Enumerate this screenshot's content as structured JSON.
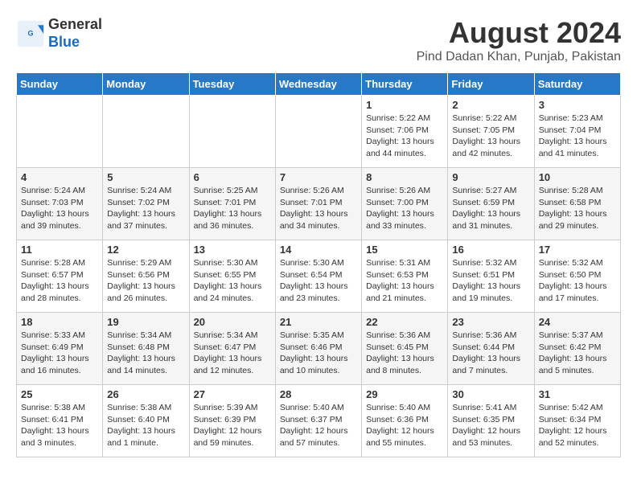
{
  "header": {
    "logo_line1": "General",
    "logo_line2": "Blue",
    "main_title": "August 2024",
    "subtitle": "Pind Dadan Khan, Punjab, Pakistan"
  },
  "calendar": {
    "weekdays": [
      "Sunday",
      "Monday",
      "Tuesday",
      "Wednesday",
      "Thursday",
      "Friday",
      "Saturday"
    ],
    "weeks": [
      [
        {
          "day": "",
          "info": ""
        },
        {
          "day": "",
          "info": ""
        },
        {
          "day": "",
          "info": ""
        },
        {
          "day": "",
          "info": ""
        },
        {
          "day": "1",
          "info": "Sunrise: 5:22 AM\nSunset: 7:06 PM\nDaylight: 13 hours\nand 44 minutes."
        },
        {
          "day": "2",
          "info": "Sunrise: 5:22 AM\nSunset: 7:05 PM\nDaylight: 13 hours\nand 42 minutes."
        },
        {
          "day": "3",
          "info": "Sunrise: 5:23 AM\nSunset: 7:04 PM\nDaylight: 13 hours\nand 41 minutes."
        }
      ],
      [
        {
          "day": "4",
          "info": "Sunrise: 5:24 AM\nSunset: 7:03 PM\nDaylight: 13 hours\nand 39 minutes."
        },
        {
          "day": "5",
          "info": "Sunrise: 5:24 AM\nSunset: 7:02 PM\nDaylight: 13 hours\nand 37 minutes."
        },
        {
          "day": "6",
          "info": "Sunrise: 5:25 AM\nSunset: 7:01 PM\nDaylight: 13 hours\nand 36 minutes."
        },
        {
          "day": "7",
          "info": "Sunrise: 5:26 AM\nSunset: 7:01 PM\nDaylight: 13 hours\nand 34 minutes."
        },
        {
          "day": "8",
          "info": "Sunrise: 5:26 AM\nSunset: 7:00 PM\nDaylight: 13 hours\nand 33 minutes."
        },
        {
          "day": "9",
          "info": "Sunrise: 5:27 AM\nSunset: 6:59 PM\nDaylight: 13 hours\nand 31 minutes."
        },
        {
          "day": "10",
          "info": "Sunrise: 5:28 AM\nSunset: 6:58 PM\nDaylight: 13 hours\nand 29 minutes."
        }
      ],
      [
        {
          "day": "11",
          "info": "Sunrise: 5:28 AM\nSunset: 6:57 PM\nDaylight: 13 hours\nand 28 minutes."
        },
        {
          "day": "12",
          "info": "Sunrise: 5:29 AM\nSunset: 6:56 PM\nDaylight: 13 hours\nand 26 minutes."
        },
        {
          "day": "13",
          "info": "Sunrise: 5:30 AM\nSunset: 6:55 PM\nDaylight: 13 hours\nand 24 minutes."
        },
        {
          "day": "14",
          "info": "Sunrise: 5:30 AM\nSunset: 6:54 PM\nDaylight: 13 hours\nand 23 minutes."
        },
        {
          "day": "15",
          "info": "Sunrise: 5:31 AM\nSunset: 6:53 PM\nDaylight: 13 hours\nand 21 minutes."
        },
        {
          "day": "16",
          "info": "Sunrise: 5:32 AM\nSunset: 6:51 PM\nDaylight: 13 hours\nand 19 minutes."
        },
        {
          "day": "17",
          "info": "Sunrise: 5:32 AM\nSunset: 6:50 PM\nDaylight: 13 hours\nand 17 minutes."
        }
      ],
      [
        {
          "day": "18",
          "info": "Sunrise: 5:33 AM\nSunset: 6:49 PM\nDaylight: 13 hours\nand 16 minutes."
        },
        {
          "day": "19",
          "info": "Sunrise: 5:34 AM\nSunset: 6:48 PM\nDaylight: 13 hours\nand 14 minutes."
        },
        {
          "day": "20",
          "info": "Sunrise: 5:34 AM\nSunset: 6:47 PM\nDaylight: 13 hours\nand 12 minutes."
        },
        {
          "day": "21",
          "info": "Sunrise: 5:35 AM\nSunset: 6:46 PM\nDaylight: 13 hours\nand 10 minutes."
        },
        {
          "day": "22",
          "info": "Sunrise: 5:36 AM\nSunset: 6:45 PM\nDaylight: 13 hours\nand 8 minutes."
        },
        {
          "day": "23",
          "info": "Sunrise: 5:36 AM\nSunset: 6:44 PM\nDaylight: 13 hours\nand 7 minutes."
        },
        {
          "day": "24",
          "info": "Sunrise: 5:37 AM\nSunset: 6:42 PM\nDaylight: 13 hours\nand 5 minutes."
        }
      ],
      [
        {
          "day": "25",
          "info": "Sunrise: 5:38 AM\nSunset: 6:41 PM\nDaylight: 13 hours\nand 3 minutes."
        },
        {
          "day": "26",
          "info": "Sunrise: 5:38 AM\nSunset: 6:40 PM\nDaylight: 13 hours\nand 1 minute."
        },
        {
          "day": "27",
          "info": "Sunrise: 5:39 AM\nSunset: 6:39 PM\nDaylight: 12 hours\nand 59 minutes."
        },
        {
          "day": "28",
          "info": "Sunrise: 5:40 AM\nSunset: 6:37 PM\nDaylight: 12 hours\nand 57 minutes."
        },
        {
          "day": "29",
          "info": "Sunrise: 5:40 AM\nSunset: 6:36 PM\nDaylight: 12 hours\nand 55 minutes."
        },
        {
          "day": "30",
          "info": "Sunrise: 5:41 AM\nSunset: 6:35 PM\nDaylight: 12 hours\nand 53 minutes."
        },
        {
          "day": "31",
          "info": "Sunrise: 5:42 AM\nSunset: 6:34 PM\nDaylight: 12 hours\nand 52 minutes."
        }
      ]
    ]
  }
}
